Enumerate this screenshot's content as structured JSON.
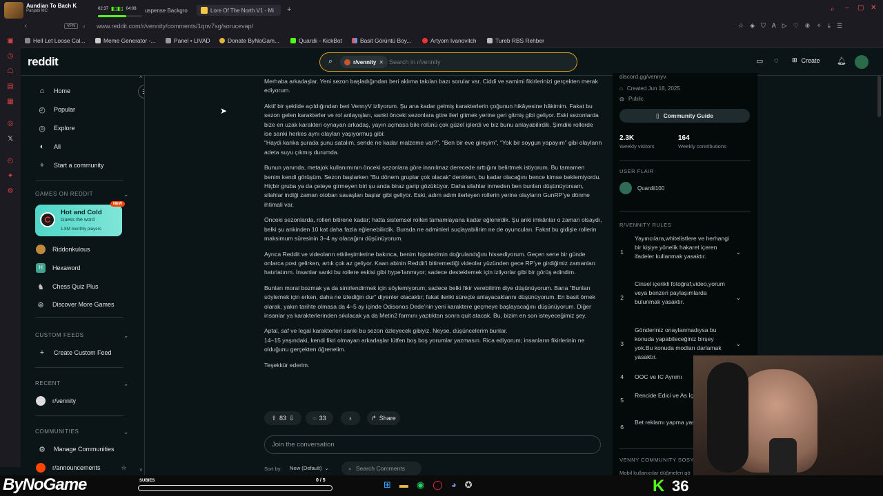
{
  "browser": {
    "media": {
      "title": "Aundian To Bach K",
      "artist": "Panjabi MC",
      "time_current": "02:37",
      "time_total": "04:08"
    },
    "tabs": [
      {
        "label": "uspense Backgro"
      },
      {
        "label": "Lore Of The North V1 - Mi"
      }
    ],
    "url": "www.reddit.com/r/vennity/comments/1qnv7sg/sorucevap/",
    "vpn_label": "VPN",
    "bookmarks": [
      "Hell Let Loose Cal...",
      "Meme Generator -...",
      "Panel • LIVAD",
      "Donate ByNoGam...",
      "Quardii - KickBot",
      "Basit Görüntü Boy...",
      "Artyom Ivanovitch",
      "Tureb RBS Rehber"
    ]
  },
  "header": {
    "logo": "reddit",
    "search_chip": "r/vennity",
    "search_placeholder": "Search in r/vennity",
    "create_label": "Create"
  },
  "sidebar": {
    "nav": [
      {
        "label": "Home",
        "icon": "home-icon"
      },
      {
        "label": "Popular",
        "icon": "popular-icon"
      },
      {
        "label": "Explore",
        "icon": "explore-icon"
      },
      {
        "label": "All",
        "icon": "all-icon"
      },
      {
        "label": "Start a community",
        "icon": "plus-icon"
      }
    ],
    "games_title": "GAMES ON REDDIT",
    "featured_game": {
      "title": "Hot and Cold",
      "subtitle": "Guess the word",
      "players": "1.8M monthly players",
      "badge": "NEW"
    },
    "games": [
      "Riddonkulous",
      "Hexaword",
      "Chess Quiz Plus",
      "Discover More Games"
    ],
    "custom_feeds_title": "CUSTOM FEEDS",
    "create_custom_feed": "Create Custom Feed",
    "recent_title": "RECENT",
    "recent": [
      "r/vennity"
    ],
    "communities_title": "COMMUNITIES",
    "manage_communities": "Manage Communities",
    "communities": [
      "r/announcements"
    ]
  },
  "post": {
    "paragraphs": [
      "Merhaba arkadaşlar. Yeni sezon başladığından beri aklıma takılan bazı sorular var. Ciddi ve samimi fikirlerinizi gerçekten merak ediyorum.",
      "Aktif bir şekilde açıldığından beri VennyV izliyorum. Şu ana kadar gelmiş karakterlerin çoğunun hikâyesine hâkimim. Fakat bu sezon gelen karakterler ve rol anlayışları, sanki önceki sezonlara göre ileri gitmek yerine geri gitmiş gibi geliyor. Eski sezonlarda bize en uzak karakteri oynayan arkadaş, yayın açmasa bile rolünü çok güzel işlerdi ve biz bunu anlayabilirdik. Şimdiki rollerde ise sanki herkes aynı olayları yaşıyormuş gibi:\n“Haydi kanka şurada şunu satalım, sende ne kadar malzeme var?”, “Ben bir eve gireyim”, “Yok bir soygun yapayım” gibi olayların adeta suyu çıkmış durumda.",
      "Bunun yanında, metajok kullanımının önceki sezonlara göre inanılmaz derecede arttığını belirtmek istiyorum. Bu tamamen benim kendi görüşüm. Sezon başlarken “Bu dönem gruplar çok olacak” denirken, bu kadar olacağını bence kimse beklemiyordu. Hiçbir gruba ya da çeteye girmeyen biri şu anda biraz garip gözüküyor. Daha silahlar inmeden ben bunları düşünüyorsam, silahlar indiği zaman otoban savaşları başlar gibi geliyor. Eski, adım adım ilerleyen rollerin yerine olayların GunRP’ye dönme ihtimali var.",
      "Önceki sezonlarda, rolleri bitirene kadar; hatta sistemsel rolleri tamamlayana kadar eğlenirdik. Şu anki imkânlar o zaman olsaydı, belki şu ankinden 10 kat daha fazla eğlenebilirdik. Burada ne adminleri suçlayabilirim ne de oyuncuları. Fakat bu gidişle rollerin maksimum süresinin 3–4 ay olacağını düşünüyorum.",
      "Ayrıca Reddit ve videoların etkileşimlerine bakınca, benim hipotezimin doğrulandığını hissediyorum. Geçen sene bir günde onlarca post gelirken, artık çok az geliyor. Kaan abinin Reddit’i bitiremediği videolar yüzünden gece RP’ye girdiğimiz zamanları hatırlatırım. İnsanlar sanki bu rollere eskisi gibi hype’lanmıyor; sadece desteklemek için izliyorlar gibi bir görüş edindim.",
      "Bunları moral bozmak ya da sinirlendirmek için söylemiyorum; sadece belki fikir verebilirim diye düşünüyorum. Bana “Bunları söylemek için erken, daha ne izlediğin dur” diyenler olacaktır; fakat ileriki süreçte anlayacaklarını düşünüyorum. En basit örnek olarak, yakın tarihte olmasa da 4–5 ay içinde Odisonos Dede’nin yeni karaktere geçmeye başlayacağını düşünüyorum. Diğer insanlar ya karakterlerinden sıkılacak ya da Metin2 farmını yaptıktan sonra quit atacak. Bu, bizim en son isteyeceğimiz şey.",
      "Aptal, saf ve legal karakterleri sanki bu sezon özleyecek gibiyiz. Neyse, düşüncelerim bunlar.\n14–15 yaşındaki, kendi fikri olmayan arkadaşlar lütfen boş boş yorumlar yazmasın. Rica ediyorum; insanların fikirlerinin ne olduğunu gerçekten öğrenelim.",
      "Teşekkür ederim."
    ],
    "votes": "83",
    "comments": "33",
    "share_label": "Share",
    "join_placeholder": "Join the conversation",
    "sort_label": "Sort by:",
    "sort_value": "New (Default)",
    "search_comments": "Search Comments"
  },
  "right_sidebar": {
    "discord": "discord.gg/vennyv",
    "created": "Created Jun 18, 2025",
    "visibility": "Public",
    "guide_button": "Community Guide",
    "stats": [
      {
        "value": "2.3K",
        "label": "Weekly visitors"
      },
      {
        "value": "164",
        "label": "Weekly contributions"
      }
    ],
    "user_flair_title": "USER FLAIR",
    "user_flair": "Quardii100",
    "rules_title": "R/VENNITY RULES",
    "rules": [
      {
        "n": "1",
        "text": "Yayıncılara,whitelistlere ve herhangi bir kişiye yönelik hakaret içeren ifadeler kullanmak yasaktır."
      },
      {
        "n": "2",
        "text": "Cinsel içerikli fotoğraf,video,yorum veya benzeri paylaşımlarda bulunmak yasaktır."
      },
      {
        "n": "3",
        "text": "Gönderiniz onaylanmadıysa bu konuda yapabileceğiniz birşey yok.Bu konuda modları darlamak yasaktır."
      },
      {
        "n": "4",
        "text": "OOC ve IC Ayrımı"
      },
      {
        "n": "5",
        "text": "Rencide Edici ve As İçerik Yasaktır"
      },
      {
        "n": "6",
        "text": "Bet reklamı yapma yasaktır."
      }
    ],
    "bottom_title": "VENNY COMMUNITY SOSYAL",
    "bottom_text": "Mobil kullanıcılar düğmeleri gö"
  },
  "stream_overlay": {
    "brand": "ByNoGame",
    "subs_label": "SUBIES",
    "subs_progress": "0 / 5",
    "viewer_count": "36"
  },
  "colors": {
    "accent": "#ff4500",
    "green": "#53fc18",
    "bg": "#0b1416"
  }
}
